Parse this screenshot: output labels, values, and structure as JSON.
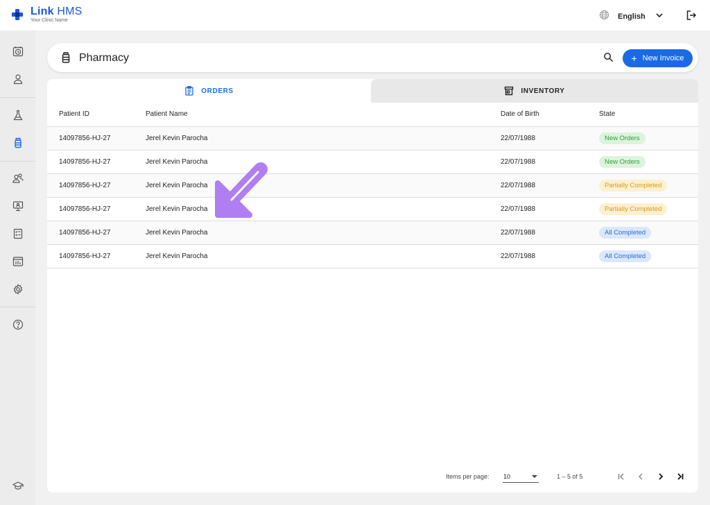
{
  "app": {
    "brand_link": "Link",
    "brand_hms": "HMS",
    "clinic_name": "Your Clinic Name"
  },
  "topbar": {
    "language": "English"
  },
  "sidebar": {
    "items": [
      {
        "icon": "clock-icon"
      },
      {
        "icon": "user-icon"
      },
      {
        "icon": "flask-icon"
      },
      {
        "icon": "medicine-bottle-icon",
        "active": true
      },
      {
        "icon": "users-icon"
      },
      {
        "icon": "monitor-icon"
      },
      {
        "icon": "report-icon"
      },
      {
        "icon": "chart-icon"
      },
      {
        "icon": "gear-icon"
      },
      {
        "icon": "help-icon"
      },
      {
        "icon": "graduation-cap-icon"
      }
    ]
  },
  "header": {
    "title": "Pharmacy",
    "new_invoice_label": "New Invoice"
  },
  "tabs": [
    {
      "label": "ORDERS",
      "active": true
    },
    {
      "label": "INVENTORY",
      "active": false
    }
  ],
  "table": {
    "columns": [
      "Patient ID",
      "Patient Name",
      "Date of Birth",
      "State"
    ],
    "rows": [
      {
        "id": "14097856-HJ-27",
        "name": "Jerel Kevin Parocha",
        "dob": "22/07/1988",
        "state": "New Orders",
        "state_kind": "new"
      },
      {
        "id": "14097856-HJ-27",
        "name": "Jerel Kevin Parocha",
        "dob": "22/07/1988",
        "state": "New Orders",
        "state_kind": "new"
      },
      {
        "id": "14097856-HJ-27",
        "name": "Jerel Kevin Parocha",
        "dob": "22/07/1988",
        "state": "Partially Completed",
        "state_kind": "partial"
      },
      {
        "id": "14097856-HJ-27",
        "name": "Jerel Kevin Parocha",
        "dob": "22/07/1988",
        "state": "Partially Completed",
        "state_kind": "partial"
      },
      {
        "id": "14097856-HJ-27",
        "name": "Jerel Kevin Parocha",
        "dob": "22/07/1988",
        "state": "All Completed",
        "state_kind": "all"
      },
      {
        "id": "14097856-HJ-27",
        "name": "Jerel Kevin Parocha",
        "dob": "22/07/1988",
        "state": "All Completed",
        "state_kind": "all"
      }
    ]
  },
  "pagination": {
    "items_per_page_label": "Items per page:",
    "items_per_page": "10",
    "range": "1 – 5 of 5"
  },
  "colors": {
    "accent": "#1a6ae6",
    "annotation_arrow": "#b07ef0"
  }
}
